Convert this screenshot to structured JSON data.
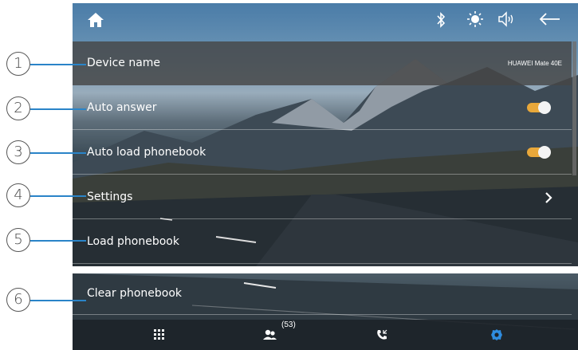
{
  "status_bar": {
    "home_icon": "home-icon",
    "bluetooth_icon": "bluetooth-icon",
    "brightness_icon": "brightness-icon",
    "volume_icon": "volume-icon",
    "back_icon": "back-arrow-icon"
  },
  "rows": [
    {
      "label": "Device name",
      "value": "HUAWEI Mate 40E"
    },
    {
      "label": "Auto answer",
      "toggle": "on"
    },
    {
      "label": "Auto load phonebook",
      "toggle": "on"
    },
    {
      "label": "Settings",
      "icon": "chevron-right-icon"
    },
    {
      "label": "Load phonebook"
    },
    {
      "label": "Clear phonebook"
    }
  ],
  "bottom_nav": {
    "dialpad_icon": "dialpad-icon",
    "contacts_icon": "contacts-icon",
    "contacts_count": "(53)",
    "calls_icon": "call-log-icon",
    "settings_icon": "settings-icon"
  },
  "callouts": [
    "1",
    "2",
    "3",
    "4",
    "5",
    "6"
  ],
  "colors": {
    "toggle_on": "#e9a83a",
    "active_nav": "#2f8de0",
    "leader_line": "#2a84c8"
  }
}
